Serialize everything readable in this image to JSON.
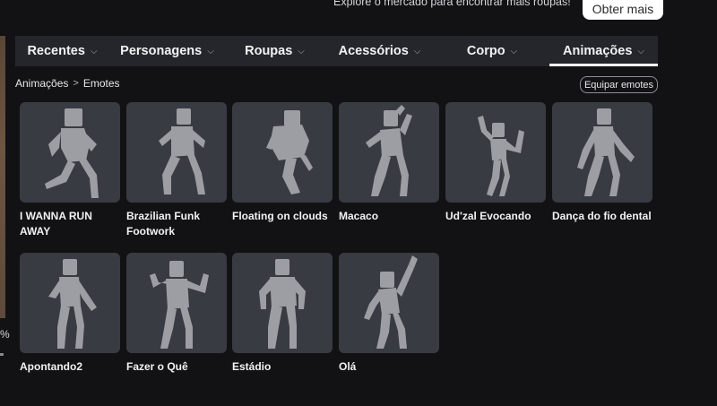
{
  "promo": {
    "text": "Explore o mercado para encontrar mais roupas!",
    "button_label": "Obter mais"
  },
  "left_panel": {
    "percent_text": "%"
  },
  "tabs": [
    {
      "label": "Recentes",
      "active": false
    },
    {
      "label": "Personagens",
      "active": false
    },
    {
      "label": "Roupas",
      "active": false
    },
    {
      "label": "Acessórios",
      "active": false
    },
    {
      "label": "Corpo",
      "active": false
    },
    {
      "label": "Animações",
      "active": true
    }
  ],
  "tab_chevron": "⌵",
  "breadcrumb": {
    "parent": "Animações",
    "separator": ">",
    "current": "Emotes"
  },
  "equip_button": "Equipar emotes",
  "items": [
    {
      "title": "I WANNA RUN AWAY",
      "icon": "run-pose-icon"
    },
    {
      "title": "Brazilian Funk Footwork",
      "icon": "funk-pose-icon"
    },
    {
      "title": "Floating on clouds",
      "icon": "float-pose-icon"
    },
    {
      "title": "Macaco",
      "icon": "monkey-pose-icon"
    },
    {
      "title": "Ud'zal Evocando",
      "icon": "summon-pose-icon"
    },
    {
      "title": "Dança do fio dental",
      "icon": "floss-pose-icon"
    },
    {
      "title": "Apontando2",
      "icon": "point-pose-icon"
    },
    {
      "title": "Fazer o Quê",
      "icon": "shrug-pose-icon"
    },
    {
      "title": "Estádio",
      "icon": "stadium-pose-icon"
    },
    {
      "title": "Olá",
      "icon": "wave-pose-icon"
    }
  ],
  "colors": {
    "background": "#121215",
    "tab_bar": "#25262b",
    "card": "#393b42",
    "figure": "#9d9ea3"
  }
}
